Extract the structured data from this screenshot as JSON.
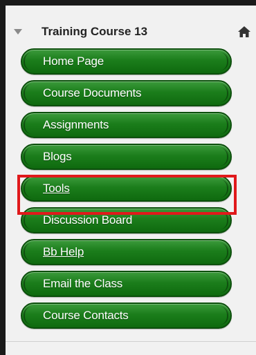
{
  "course": {
    "title": "Training Course 13"
  },
  "menu": {
    "items": [
      {
        "label": "Home Page"
      },
      {
        "label": "Course Documents"
      },
      {
        "label": "Assignments"
      },
      {
        "label": "Blogs"
      },
      {
        "label": "Tools"
      },
      {
        "label": "Discussion Board"
      },
      {
        "label": "Bb Help"
      },
      {
        "label": "Email the Class"
      },
      {
        "label": "Course Contacts"
      }
    ]
  },
  "colors": {
    "button_green": "#1b7d1b",
    "highlight_red": "#e0191b"
  },
  "icons": {
    "collapse": "triangle-down-icon",
    "home": "home-icon"
  }
}
